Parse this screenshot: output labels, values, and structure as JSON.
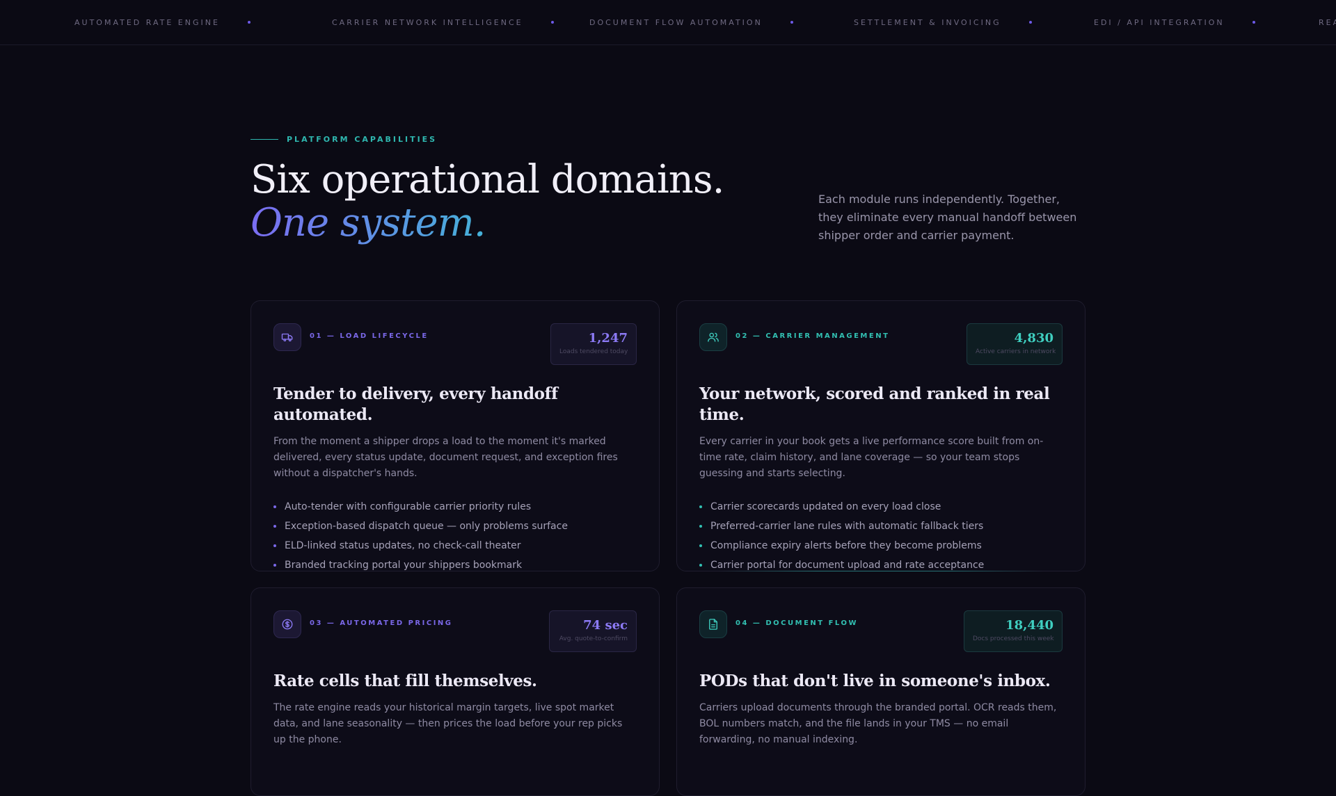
{
  "ticker": {
    "items": [
      "AUTOMATED RATE ENGINE",
      "CARRIER NETWORK INTELLIGENCE",
      "DOCUMENT FLOW AUTOMATION",
      "SETTLEMENT & INVOICING",
      "EDI / API INTEGRATION",
      "REA"
    ]
  },
  "header": {
    "eyebrow": "PLATFORM CAPABILITIES",
    "headline": "Six operational domains.",
    "headline_accent": "One system.",
    "intro": "Each module runs independently. Together, they eliminate every manual handoff between shipper order and carrier payment."
  },
  "cards": [
    {
      "tag": "01 — LOAD LIFECYCLE",
      "icon": "truck-icon",
      "stat_value": "1,247",
      "stat_label": "Loads tendered today",
      "title": "Tender to delivery, every handoff automated.",
      "description": "From the moment a shipper drops a load to the moment it's marked delivered, every status update, document request, and exception fires without a dispatcher's hands.",
      "bullets": [
        "Auto-tender with configurable carrier priority rules",
        "Exception-based dispatch queue — only problems surface",
        "ELD-linked status updates, no check-call theater",
        "Branded tracking portal your shippers bookmark"
      ]
    },
    {
      "tag": "02 — CARRIER MANAGEMENT",
      "icon": "users-icon",
      "stat_value": "4,830",
      "stat_label": "Active carriers in network",
      "title": "Your network, scored and ranked in real time.",
      "description": "Every carrier in your book gets a live performance score built from on-time rate, claim history, and lane coverage — so your team stops guessing and starts selecting.",
      "bullets": [
        "Carrier scorecards updated on every load close",
        "Preferred-carrier lane rules with automatic fallback tiers",
        "Compliance expiry alerts before they become problems",
        "Carrier portal for document upload and rate acceptance"
      ]
    },
    {
      "tag": "03 — AUTOMATED PRICING",
      "icon": "dollar-icon",
      "stat_value": "74 sec",
      "stat_label": "Avg. quote-to-confirm",
      "title": "Rate cells that fill themselves.",
      "description": "The rate engine reads your historical margin targets, live spot market data, and lane seasonality — then prices the load before your rep picks up the phone.",
      "bullets": []
    },
    {
      "tag": "04 — DOCUMENT FLOW",
      "icon": "document-icon",
      "stat_value": "18,440",
      "stat_label": "Docs processed this week",
      "title": "PODs that don't live in someone's inbox.",
      "description": "Carriers upload documents through the branded portal. OCR reads them, BOL numbers match, and the file lands in your TMS — no email forwarding, no manual indexing.",
      "bullets": []
    }
  ],
  "colors": {
    "background": "#0b0a14",
    "accent_purple": "#7a68e8",
    "accent_teal": "#32c0b2"
  }
}
